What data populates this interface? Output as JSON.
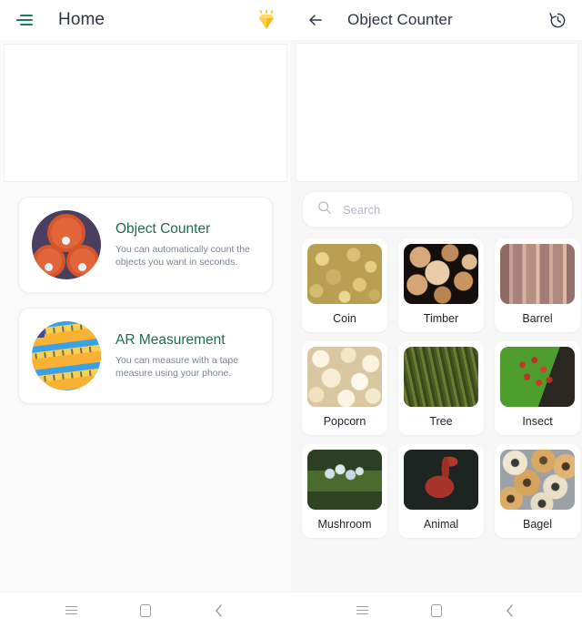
{
  "left_screen": {
    "appbar": {
      "menu_icon": "tune-icon",
      "title": "Home",
      "premium_icon": "diamond-gem-icon"
    },
    "banner": {
      "label": ""
    },
    "features": [
      {
        "icon": "barrels-circle-icon",
        "title": "Object Counter",
        "description": "You can automatically count the objects you want in seconds."
      },
      {
        "icon": "tape-measure-circle-icon",
        "title": "AR Measurement",
        "description": "You can measure with a tape measure using your phone."
      }
    ],
    "navbar": {
      "recents": "recents-icon",
      "home": "home-icon",
      "back": "back-icon"
    }
  },
  "right_screen": {
    "appbar": {
      "back_icon": "arrow-left-icon",
      "title": "Object Counter",
      "history_icon": "history-icon"
    },
    "banner": {
      "label": ""
    },
    "search": {
      "icon": "search-icon",
      "placeholder": "Search",
      "value": ""
    },
    "categories": [
      {
        "label": "Coin",
        "thumb": "tx-coin"
      },
      {
        "label": "Timber",
        "thumb": "tx-timber"
      },
      {
        "label": "Barrel",
        "thumb": "tx-barrel"
      },
      {
        "label": "Popcorn",
        "thumb": "tx-popcorn"
      },
      {
        "label": "Tree",
        "thumb": "tx-tree"
      },
      {
        "label": "Insect",
        "thumb": "tx-insect"
      },
      {
        "label": "Mushroom",
        "thumb": "tx-mushroom"
      },
      {
        "label": "Animal",
        "thumb": "tx-animal"
      },
      {
        "label": "Bagel",
        "thumb": "tx-bagel"
      }
    ],
    "navbar": {
      "recents": "recents-icon",
      "home": "home-icon",
      "back": "back-icon"
    }
  },
  "colors": {
    "accent_green": "#1d6b52",
    "title_dark": "#2b3445",
    "body_gray": "#7c8494",
    "gem_gold": "#f6c445",
    "barrel_orange": "#e2663a",
    "barrel_bg_purple": "#4a3f5f",
    "tape_blue": "#3aa0e8"
  }
}
